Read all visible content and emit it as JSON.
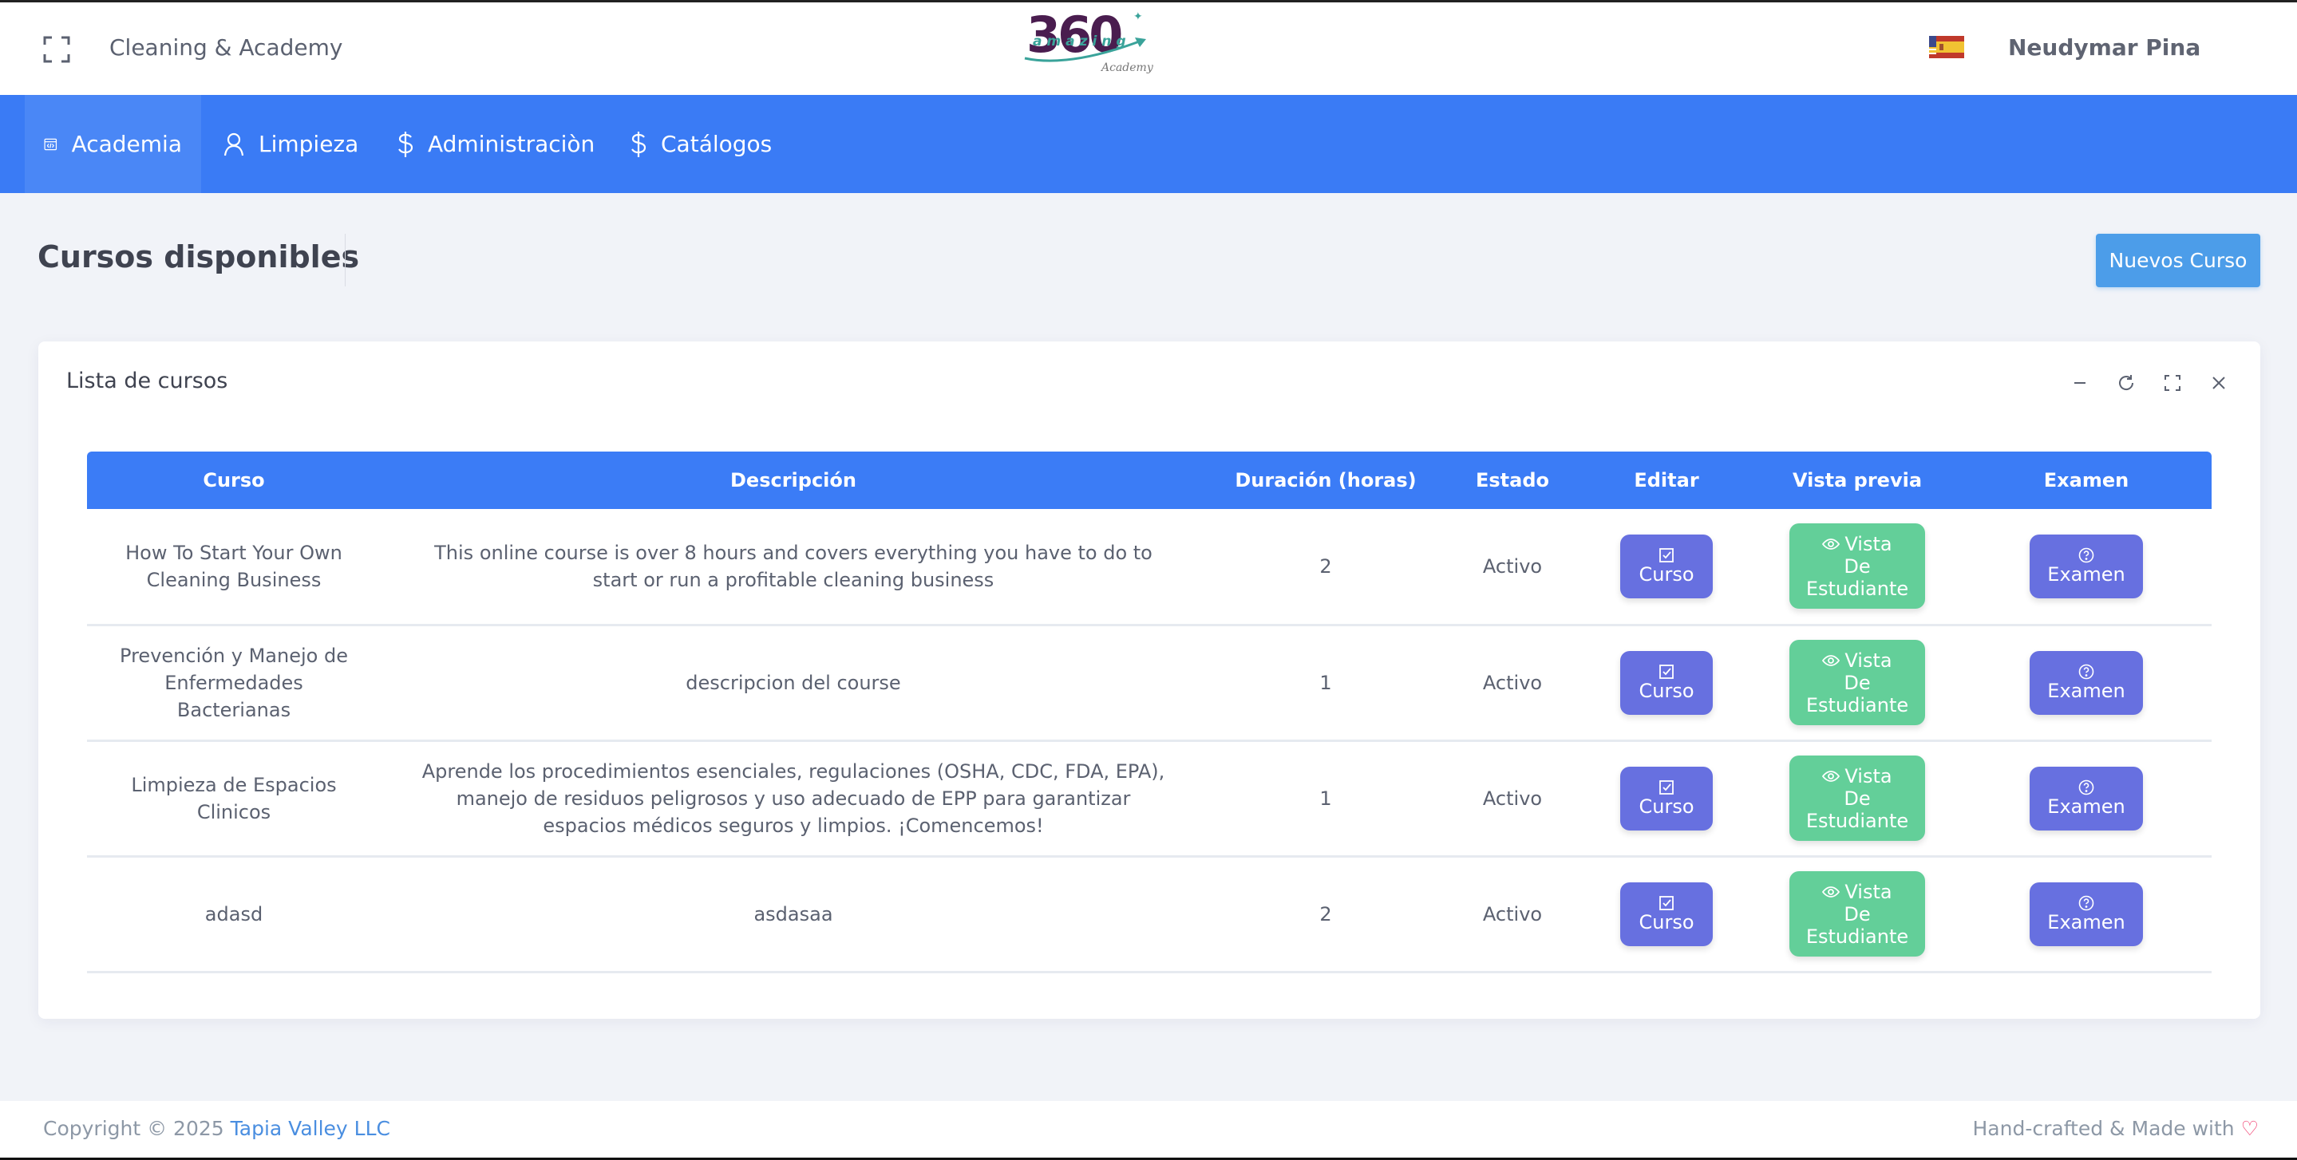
{
  "header": {
    "app_name": "Cleaning & Academy",
    "logo_text": "360 amazing Academy",
    "language_flag": "es-flag",
    "user_name": "Neudymar Pina"
  },
  "nav": {
    "items": [
      {
        "label": "Academia",
        "icon": "code-window-icon",
        "active": true
      },
      {
        "label": "Limpieza",
        "icon": "user-icon",
        "active": false
      },
      {
        "label": "Administraciòn",
        "icon": "dollar-icon",
        "active": false
      },
      {
        "label": "Catálogos",
        "icon": "dollar-icon",
        "active": false
      }
    ]
  },
  "page": {
    "title": "Cursos disponibles",
    "new_button": "Nuevos Curso"
  },
  "card": {
    "title": "Lista de cursos",
    "tools": [
      "minimize-icon",
      "refresh-icon",
      "fullscreen-icon",
      "close-icon"
    ]
  },
  "table": {
    "headers": [
      "Curso",
      "Descripción",
      "Duración (horas)",
      "Estado",
      "Editar",
      "Vista previa",
      "Examen"
    ],
    "rows": [
      {
        "curso": "How To Start Your Own Cleaning Business",
        "descripcion": "This online course is over 8 hours and covers everything you have to do to start or run a profitable cleaning business",
        "duracion": "2",
        "estado": "Activo"
      },
      {
        "curso": "Prevención y Manejo de Enfermedades Bacterianas",
        "descripcion": "descripcion del course",
        "duracion": "1",
        "estado": "Activo"
      },
      {
        "curso": "Limpieza de Espacios Clinicos",
        "descripcion": "Aprende los procedimientos esenciales, regulaciones (OSHA, CDC, FDA, EPA), manejo de residuos peligrosos y uso adecuado de EPP para garantizar espacios médicos seguros y limpios. ¡Comencemos!",
        "duracion": "1",
        "estado": "Activo"
      },
      {
        "curso": "adasd",
        "descripcion": "asdasaa",
        "duracion": "2",
        "estado": "Activo"
      }
    ],
    "buttons": {
      "edit": "Curso",
      "preview_l1": "Vista",
      "preview_l2": "De",
      "preview_l3": "Estudiante",
      "exam": "Examen"
    }
  },
  "footer": {
    "copyright": "Copyright © 2025",
    "company": "Tapia Valley LLC",
    "made_with": "Hand-crafted & Made with"
  },
  "colors": {
    "nav": "#3a7bf5",
    "primary_button": "#4c9de9",
    "action_purple": "#6770e0",
    "action_green": "#63cf99"
  }
}
